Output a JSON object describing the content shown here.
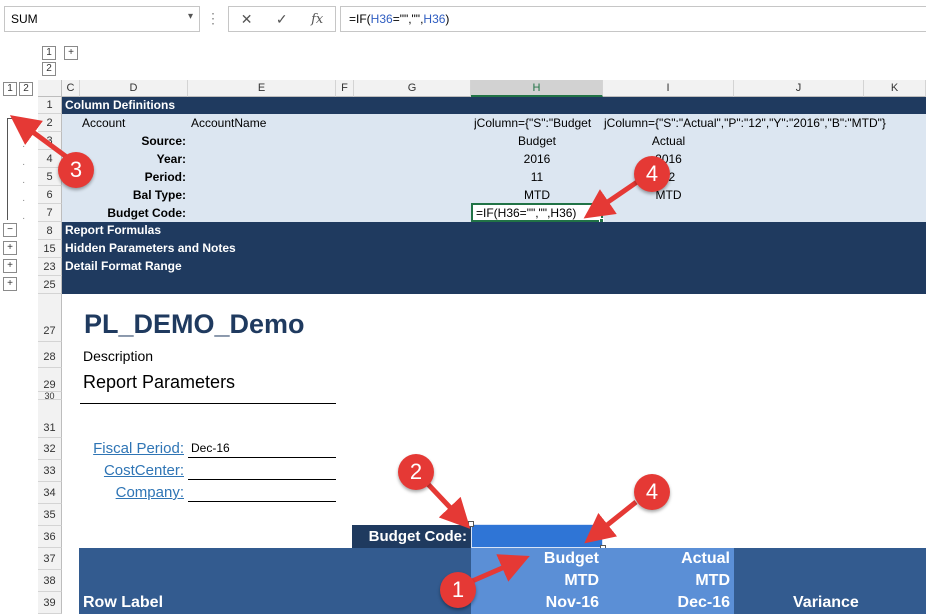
{
  "formula_bar": {
    "name_box": "SUM",
    "formula_prefix": "=IF(",
    "formula_ref1": "H36",
    "formula_mid": "=\"\",\"\",",
    "formula_ref2": "H36",
    "formula_suffix": ")"
  },
  "outline": {
    "col_levels": [
      "1",
      "2"
    ],
    "row_levels": [
      "1",
      "2"
    ],
    "expand": "+",
    "collapse": "−"
  },
  "columns": [
    "C",
    "D",
    "E",
    "F",
    "G",
    "H",
    "I",
    "J",
    "K"
  ],
  "rows": [
    "1",
    "2",
    "3",
    "4",
    "5",
    "6",
    "7",
    "8",
    "15",
    "23",
    "25",
    "27",
    "28",
    "29",
    "30",
    "31",
    "32",
    "33",
    "34",
    "35",
    "36",
    "37",
    "38",
    "39"
  ],
  "defs": {
    "title": "Column Definitions",
    "account": "Account",
    "account_name": "AccountName",
    "source_label": "Source:",
    "year_label": "Year:",
    "period_label": "Period:",
    "baltype_label": "Bal Type:",
    "budgetcode_label": "Budget Code:",
    "h_jcolumn": "jColumn={\"S\":\"Budget",
    "i_jcolumn": "jColumn={\"S\":\"Actual\",\"P\":\"12\",\"Y\":\"2016\",\"B\":\"MTD\"}",
    "h_source": "Budget",
    "i_source": "Actual",
    "h_year": "2016",
    "i_year": "2016",
    "h_period": "11",
    "i_period": "12",
    "h_baltype": "MTD",
    "i_baltype": "MTD",
    "h_budgetcode": "=IF(H36=\"\",\"\",H36)"
  },
  "groups": {
    "report_formulas": "Report Formulas",
    "hidden_params": "Hidden Parameters and Notes",
    "detail_format": "Detail Format Range"
  },
  "report": {
    "title": "PL_DEMO_Demo",
    "description": "Description",
    "params_title": "Report Parameters",
    "fiscal_label": "Fiscal Period:",
    "fiscal_value": "Dec-16",
    "costcenter_label": "CostCenter:",
    "company_label": "Company:",
    "budget_code_label": "Budget Code:",
    "header": {
      "row_label": "Row Label",
      "h1": "Budget",
      "h2": "MTD",
      "h3": "Nov-16",
      "i1": "Actual",
      "i2": "MTD",
      "i3": "Dec-16",
      "variance": "Variance"
    }
  },
  "callouts": [
    "1",
    "2",
    "3",
    "4",
    "4"
  ]
}
